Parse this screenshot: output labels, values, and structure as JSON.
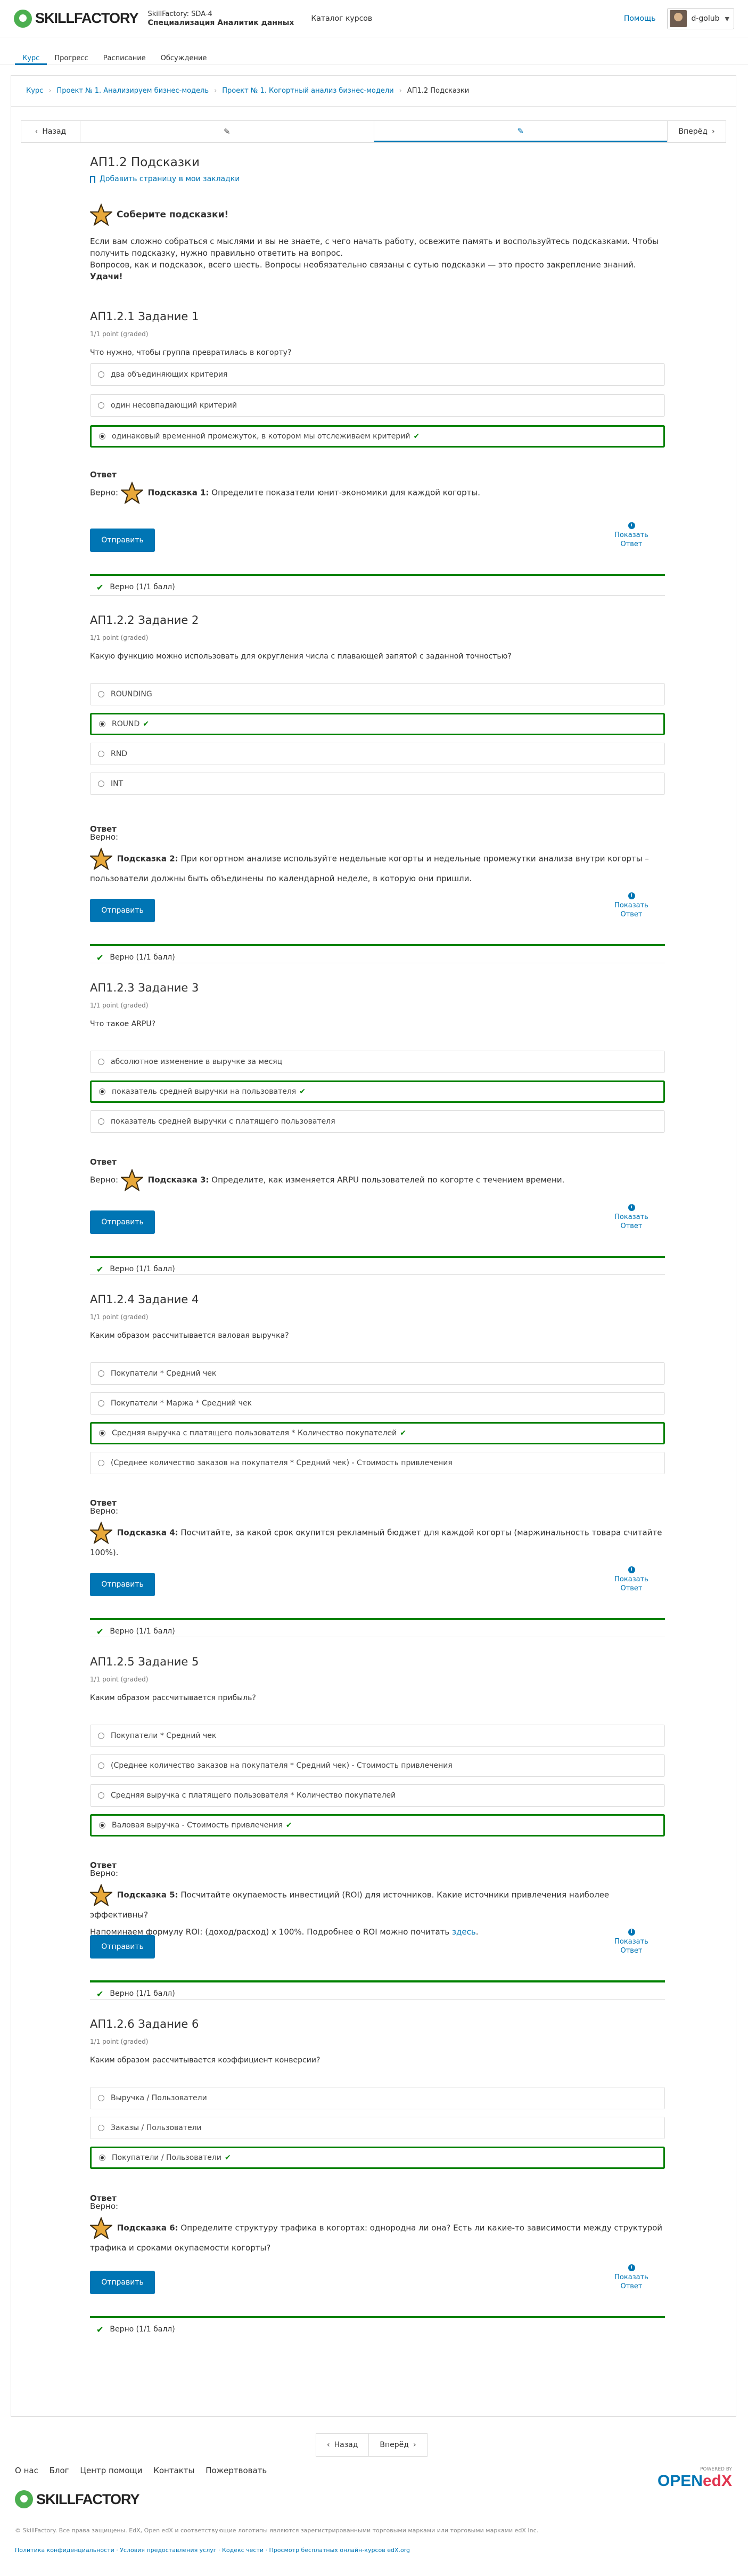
{
  "header": {
    "brand": "SKILLFACTORY",
    "course_code": "SkillFactory: SDA-4",
    "course_name": "Специализация Аналитик данных",
    "catalog": "Каталог курсов",
    "help": "Помощь",
    "username": "d-golub"
  },
  "tabs": [
    {
      "label": "Курс"
    },
    {
      "label": "Прогресс"
    },
    {
      "label": "Расписание"
    },
    {
      "label": "Обсуждение"
    }
  ],
  "breadcrumbs": [
    "Курс",
    "Проект № 1. Анализируем бизнес-модель",
    "Проект № 1. Когортный анализ бизнес-модели",
    "АП1.2 Подсказки"
  ],
  "seqnav": {
    "prev": "Назад",
    "next": "Вперёд"
  },
  "unit": {
    "title": "АП1.2 Подсказки",
    "bookmark": "Добавить страницу в мои закладки",
    "intro_heading": "Соберите подсказки!",
    "intro_p1": "Если вам сложно собраться с мыслями и вы не знаете, с чего начать работу, освежите память и воспользуйтесь подсказками. Чтобы получить подсказку, нужно правильно ответить на вопрос.",
    "intro_p2": "Вопросов, как и подсказок, всего шесть. Вопросы необязательно связаны с сутью подсказки — это просто закрепление знаний.",
    "intro_luck": "Удачи!"
  },
  "common": {
    "points": "1/1 point (graded)",
    "answer": "Ответ",
    "correct_prefix": "Верно:",
    "submit": "Отправить",
    "show_answer_1": "Показать",
    "show_answer_2": "Ответ",
    "status": "Верно (1/1 балл)"
  },
  "problems": [
    {
      "title": "АП1.2.1 Задание 1",
      "question": "Что нужно, чтобы группа превратилась в когорту?",
      "options": [
        "два объединяющих критерия",
        "один несовпадающий критерий",
        "одинаковый временной промежуток, в котором мы отслеживаем критерий"
      ],
      "selected": 2,
      "hint_label": "Подсказка 1:",
      "hint": "Определите показатели юнит-экономики для каждой когорты."
    },
    {
      "title": "АП1.2.2 Задание 2",
      "question": "Какую функцию можно использовать для округления числа с плавающей запятой с заданной точностью?",
      "options": [
        "ROUNDING",
        "ROUND",
        "RND",
        "INT"
      ],
      "selected": 1,
      "hint_label": "Подсказка 2:",
      "hint": "При когортном анализе используйте недельные когорты и недельные промежутки анализа внутри когорты – пользователи должны быть объединены по календарной неделе, в которую они пришли."
    },
    {
      "title": "АП1.2.3 Задание 3",
      "question": "Что такое ARPU?",
      "options": [
        "абсолютное изменение в выручке за месяц",
        "показатель средней выручки на пользователя",
        "показатель средней выручки с платящего пользователя"
      ],
      "selected": 1,
      "hint_label": "Подсказка 3:",
      "hint": "Определите, как изменяется ARPU пользователей по когорте с течением времени."
    },
    {
      "title": "АП1.2.4 Задание 4",
      "question": "Каким образом рассчитывается валовая выручка?",
      "options": [
        "Покупатели * Средний чек",
        "Покупатели * Маржа * Средний чек",
        "Средняя выручка с платящего пользователя * Количество покупателей",
        "(Среднее количество заказов на покупателя * Средний чек) - Стоимость привлечения"
      ],
      "selected": 2,
      "hint_label": "Подсказка 4:",
      "hint": "Посчитайте, за какой срок окупится рекламный бюджет для каждой когорты (маржинальность товара считайте 100%)."
    },
    {
      "title": "АП1.2.5 Задание 5",
      "question": "Каким образом рассчитывается прибыль?",
      "options": [
        "Покупатели * Средний чек",
        "(Среднее количество заказов на покупателя * Средний чек) - Стоимость привлечения",
        "Средняя выручка с платящего пользователя * Количество покупателей",
        "Валовая выручка - Стоимость привлечения"
      ],
      "selected": 3,
      "hint_label": "Подсказка 5:",
      "hint": "Посчитайте окупаемость инвестиций (ROI) для источников. Какие источники привлечения наиболее эффективны?",
      "hint_extra": "Напоминаем формулу ROI: (доход/расход) x 100%. Подробнее о ROI можно почитать",
      "hint_link": "здесь"
    },
    {
      "title": "АП1.2.6 Задание 6",
      "question": "Каким образом рассчитывается коэффициент конверсии?",
      "options": [
        "Выручка / Пользователи",
        "Заказы / Пользователи",
        "Покупатели / Пользователи"
      ],
      "selected": 2,
      "hint_label": "Подсказка 6:",
      "hint": "Определите структуру трафика в когортах: однородна ли она? Есть ли какие-то зависимости между структурой трафика и сроками окупаемости когорты?"
    }
  ],
  "bottom_nav": {
    "prev": "Назад",
    "next": "Вперёд"
  },
  "footer": {
    "links": [
      "О нас",
      "Блог",
      "Центр помощи",
      "Контакты",
      "Пожертвовать"
    ],
    "copyright": "© SkillFactory. Все права защищены. EdX, Open edX и соответствующие логотипы являются зарегистрированными торговыми марками или торговыми марками edX Inc.",
    "policy": "Политика конфиденциальности · Условия предоставления услуг · Кодекс чести · Просмотр бесплатных онлайн-курсов edX.org",
    "powered": "POWERED BY",
    "openedx": "OPEN",
    "openedx_x": "edX"
  }
}
